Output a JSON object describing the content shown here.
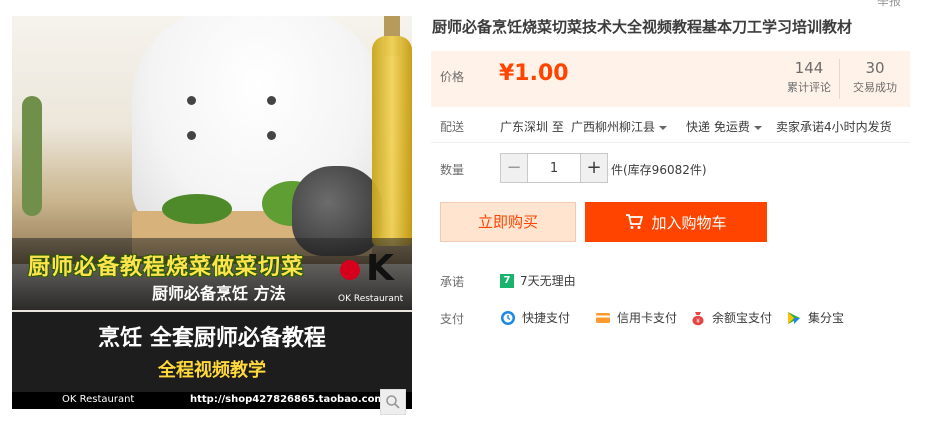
{
  "report_link": "举报",
  "image": {
    "banner_title": "厨师必备教程烧菜做菜切菜",
    "banner_subtitle": "厨师必备烹饪 方法",
    "logo_text": "K",
    "logo_name": "OK Restaurant",
    "band_title": "烹饪  全套厨师必备教程",
    "band_subtitle": "全程视频教学",
    "footer_left": "OK Restaurant",
    "footer_url": "http://shop427826865.taobao.com"
  },
  "product": {
    "title": "厨师必备烹饪烧菜切菜技术大全视频教程基本刀工学习培训教材"
  },
  "price": {
    "label": "价格",
    "value": "¥1.00",
    "reviews_count": "144",
    "reviews_label": "累计评论",
    "deals_count": "30",
    "deals_label": "交易成功"
  },
  "shipping": {
    "label": "配送",
    "from": "广东深圳 至",
    "to": "广西柳州柳江县",
    "method": "快递 免运费",
    "promise": "卖家承诺4小时内发货"
  },
  "quantity": {
    "label": "数量",
    "minus": "−",
    "value": "1",
    "plus": "+",
    "stock": "件(库存96082件)"
  },
  "actions": {
    "buy_now": "立即购买",
    "add_to_cart": "加入购物车"
  },
  "commitment": {
    "label": "承诺",
    "badge": "7",
    "text": "7天无理由"
  },
  "payment": {
    "label": "支付",
    "methods": [
      "快捷支付",
      "信用卡支付",
      "余额宝支付",
      "集分宝"
    ]
  },
  "colors": {
    "accent": "#ff4400",
    "price_bg": "#fff2e8",
    "buy_bg": "#ffe4d0"
  }
}
